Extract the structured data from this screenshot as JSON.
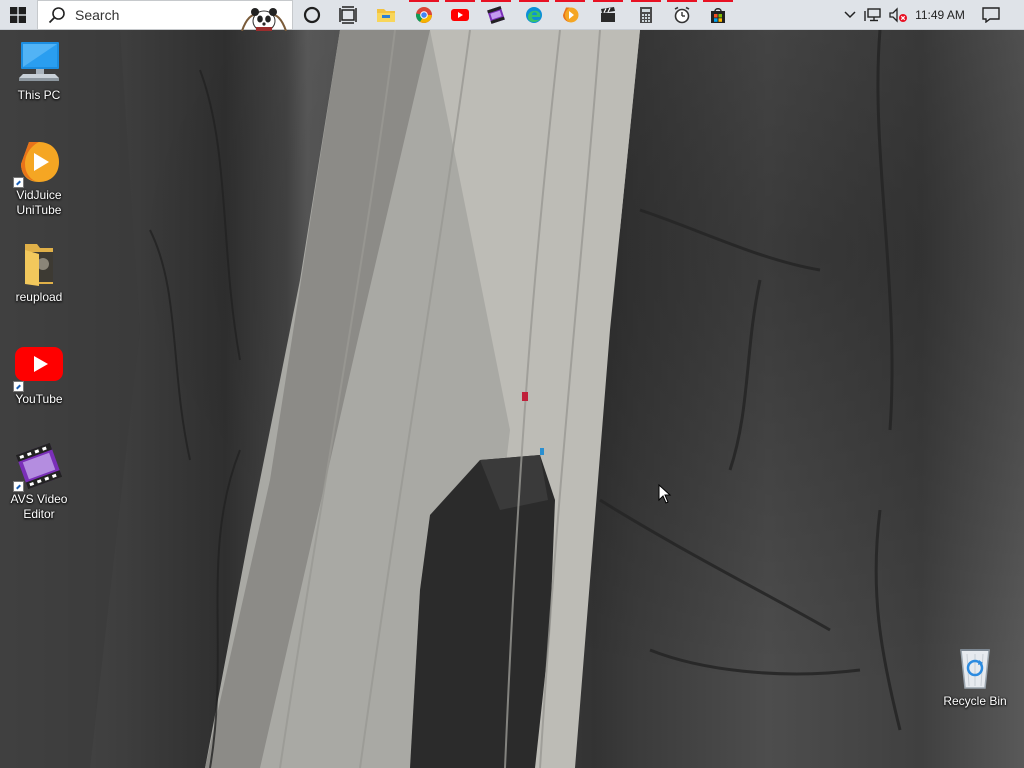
{
  "taskbar": {
    "search_placeholder": "Search",
    "pinned": [
      {
        "name": "cortana-icon"
      },
      {
        "name": "task-view-icon"
      },
      {
        "name": "file-explorer-icon"
      },
      {
        "name": "chrome-icon"
      },
      {
        "name": "youtube-icon"
      },
      {
        "name": "avs-video-editor-icon"
      },
      {
        "name": "edge-icon"
      },
      {
        "name": "vidjuice-icon"
      },
      {
        "name": "clapper-icon"
      },
      {
        "name": "calculator-icon"
      },
      {
        "name": "alarms-clock-icon"
      },
      {
        "name": "store-icon"
      }
    ],
    "clock": "11:49 AM"
  },
  "desktop": {
    "icons": [
      {
        "label": "This PC"
      },
      {
        "label": "VidJuice\nUniTube"
      },
      {
        "label": "reupload"
      },
      {
        "label": "YouTube"
      },
      {
        "label": "AVS Video\nEditor"
      },
      {
        "label": "Recycle Bin"
      }
    ]
  },
  "colors": {
    "taskbar_bg": "#dfe3e8",
    "active_indicator": "#e81123",
    "youtube_red": "#ff0000"
  }
}
